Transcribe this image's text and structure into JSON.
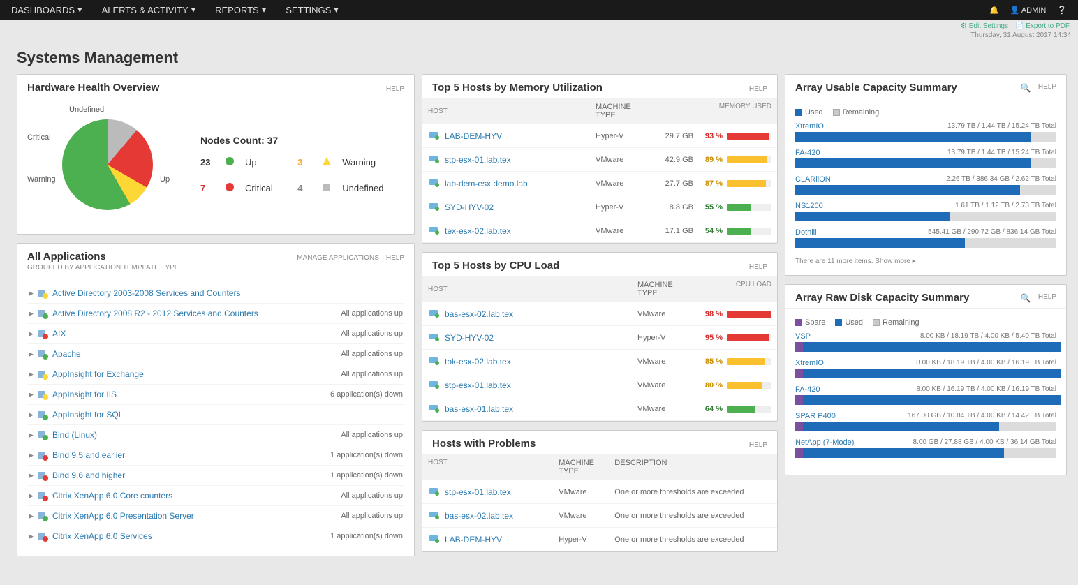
{
  "topnav": {
    "items": [
      "DASHBOARDS",
      "ALERTS & ACTIVITY",
      "REPORTS",
      "SETTINGS"
    ],
    "user": "ADMIN"
  },
  "page_title": "Systems Management",
  "datetime_line": "Thursday, 31 August 2017 14:34",
  "top_links": {
    "edit": "Edit Settings",
    "export": "Export to PDF"
  },
  "hw": {
    "title": "Hardware Health Overview",
    "help": "HELP",
    "nodes_label": "Nodes Count: 37",
    "pie_labels": {
      "undefined": "Undefined",
      "critical": "Critical",
      "warning": "Warning",
      "up": "Up"
    },
    "statuses": {
      "up": {
        "n": "23",
        "label": "Up"
      },
      "warning": {
        "n": "3",
        "label": "Warning"
      },
      "critical": {
        "n": "7",
        "label": "Critical"
      },
      "undefined": {
        "n": "4",
        "label": "Undefined"
      }
    }
  },
  "apps": {
    "title": "All Applications",
    "subtitle": "GROUPED BY APPLICATION TEMPLATE TYPE",
    "manage": "MANAGE APPLICATIONS",
    "help": "HELP",
    "rows": [
      {
        "name": "Active Directory 2003-2008 Services and Counters",
        "status": "",
        "sev": "warn"
      },
      {
        "name": "Active Directory 2008 R2 - 2012 Services and Counters",
        "status": "All applications up",
        "sev": "up"
      },
      {
        "name": "AIX",
        "status": "All applications up",
        "sev": "crit"
      },
      {
        "name": "Apache",
        "status": "All applications up",
        "sev": "up"
      },
      {
        "name": "AppInsight for Exchange",
        "status": "All applications up",
        "sev": "warn"
      },
      {
        "name": "AppInsight for IIS",
        "status": "6 application(s) down",
        "sev": "warn"
      },
      {
        "name": "AppInsight for SQL",
        "status": "",
        "sev": "up"
      },
      {
        "name": "Bind (Linux)",
        "status": "All applications up",
        "sev": "up"
      },
      {
        "name": "Bind 9.5 and earlier",
        "status": "1 application(s) down",
        "sev": "crit"
      },
      {
        "name": "Bind 9.6 and higher",
        "status": "1 application(s) down",
        "sev": "crit"
      },
      {
        "name": "Citrix XenApp 6.0 Core counters",
        "status": "All applications up",
        "sev": "crit"
      },
      {
        "name": "Citrix XenApp 6.0 Presentation Server",
        "status": "All applications up",
        "sev": "up"
      },
      {
        "name": "Citrix XenApp 6.0 Services",
        "status": "1 application(s) down",
        "sev": "crit"
      }
    ]
  },
  "memHosts": {
    "title": "Top 5 Hosts by Memory Utilization",
    "help": "HELP",
    "cols": {
      "host": "HOST",
      "type": "MACHINE TYPE",
      "mem": "MEMORY USED"
    },
    "rows": [
      {
        "name": "LAB-DEM-HYV",
        "type": "Hyper-V",
        "mem": "29.7 GB",
        "pct": 93,
        "cls": "red"
      },
      {
        "name": "stp-esx-01.lab.tex",
        "type": "VMware",
        "mem": "42.9 GB",
        "pct": 89,
        "cls": "yel"
      },
      {
        "name": "lab-dem-esx.demo.lab",
        "type": "VMware",
        "mem": "27.7 GB",
        "pct": 87,
        "cls": "yel"
      },
      {
        "name": "SYD-HYV-02",
        "type": "Hyper-V",
        "mem": "8.8 GB",
        "pct": 55,
        "cls": "grn"
      },
      {
        "name": "tex-esx-02.lab.tex",
        "type": "VMware",
        "mem": "17.1 GB",
        "pct": 54,
        "cls": "grn"
      }
    ]
  },
  "cpuHosts": {
    "title": "Top 5 Hosts by CPU Load",
    "help": "HELP",
    "cols": {
      "host": "HOST",
      "type": "MACHINE TYPE",
      "load": "CPU LOAD"
    },
    "rows": [
      {
        "name": "bas-esx-02.lab.tex",
        "type": "VMware",
        "pct": 98,
        "cls": "red"
      },
      {
        "name": "SYD-HYV-02",
        "type": "Hyper-V",
        "pct": 95,
        "cls": "red"
      },
      {
        "name": "tok-esx-02.lab.tex",
        "type": "VMware",
        "pct": 85,
        "cls": "yel"
      },
      {
        "name": "stp-esx-01.lab.tex",
        "type": "VMware",
        "pct": 80,
        "cls": "yel"
      },
      {
        "name": "bas-esx-01.lab.tex",
        "type": "VMware",
        "pct": 64,
        "cls": "grn"
      }
    ]
  },
  "problems": {
    "title": "Hosts with Problems",
    "help": "HELP",
    "cols": {
      "host": "HOST",
      "type": "MACHINE TYPE",
      "desc": "DESCRIPTION"
    },
    "rows": [
      {
        "name": "stp-esx-01.lab.tex",
        "type": "VMware",
        "desc": "One or more thresholds are exceeded"
      },
      {
        "name": "bas-esx-02.lab.tex",
        "type": "VMware",
        "desc": "One or more thresholds are exceeded"
      },
      {
        "name": "LAB-DEM-HYV",
        "type": "Hyper-V",
        "desc": "One or more thresholds are exceeded"
      }
    ]
  },
  "usable": {
    "title": "Array Usable Capacity Summary",
    "help": "HELP",
    "legend": {
      "used": "Used",
      "remaining": "Remaining"
    },
    "rows": [
      {
        "name": "XtremIO",
        "used": "13.79 TB",
        "rem": "1.44 TB",
        "total": "15.24 TB Total",
        "pct": 90
      },
      {
        "name": "FA-420",
        "used": "13.79 TB",
        "rem": "1.44 TB",
        "total": "15.24 TB Total",
        "pct": 90
      },
      {
        "name": "CLARiiON",
        "used": "2.26 TB",
        "rem": "386.34 GB",
        "total": "2.62 TB Total",
        "pct": 86
      },
      {
        "name": "NS1200",
        "used": "1.61 TB",
        "rem": "1.12 TB",
        "total": "2.73 TB Total",
        "pct": 59
      },
      {
        "name": "Dothill",
        "used": "545.41 GB",
        "rem": "290.72 GB",
        "total": "836.14 GB Total",
        "pct": 65
      }
    ],
    "footer": "There are 11 more items. Show more ▸"
  },
  "raw": {
    "title": "Array Raw Disk Capacity Summary",
    "help": "HELP",
    "legend": {
      "spare": "Spare",
      "used": "Used",
      "remaining": "Remaining"
    },
    "rows": [
      {
        "name": "VSP",
        "spare": "8.00 KB",
        "used": "18.19 TB",
        "rem": "4.00 KB",
        "total": "5.40 TB Total",
        "pct": 99
      },
      {
        "name": "XtremIO",
        "spare": "8.00 KB",
        "used": "18.19 TB",
        "rem": "4.00 KB",
        "total": "16.19 TB Total",
        "pct": 99
      },
      {
        "name": "FA-420",
        "spare": "8.00 KB",
        "used": "16.19 TB",
        "rem": "4.00 KB",
        "total": "16.19 TB Total",
        "pct": 99
      },
      {
        "name": "SPAR P400",
        "spare": "167.00 GB",
        "used": "10.84 TB",
        "rem": "4.00 KB",
        "total": "14.42 TB Total",
        "pct": 75
      },
      {
        "name": "NetApp (7-Mode)",
        "spare": "8.00 GB",
        "used": "27.88 GB",
        "rem": "4.00 KB",
        "total": "36.14 GB Total",
        "pct": 77
      }
    ]
  },
  "chart_data": {
    "type": "pie",
    "title": "Hardware Health Overview — Nodes Count: 37",
    "categories": [
      "Up",
      "Critical",
      "Undefined",
      "Warning"
    ],
    "values": [
      23,
      7,
      4,
      3
    ]
  }
}
